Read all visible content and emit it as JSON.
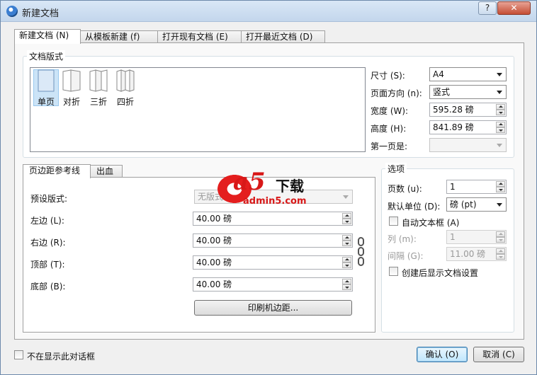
{
  "window": {
    "title": "新建文档"
  },
  "titlebar": {
    "help_label": "?",
    "close_label": "✕"
  },
  "tabs": [
    {
      "label": "新建文档 (N)"
    },
    {
      "label": "从模板新建 (f)"
    },
    {
      "label": "打开现有文档 (E)"
    },
    {
      "label": "打开最近文档 (D)"
    }
  ],
  "format": {
    "group_title": "文档版式",
    "items": [
      {
        "label": "单页",
        "icon": "single-page-icon"
      },
      {
        "label": "对折",
        "icon": "bifold-icon"
      },
      {
        "label": "三折",
        "icon": "trifold-icon"
      },
      {
        "label": "四折",
        "icon": "fourfold-icon"
      }
    ],
    "selected": "单页"
  },
  "size": {
    "size_label": "尺寸 (S):",
    "size_value": "A4",
    "orientation_label": "页面方向 (n):",
    "orientation_value": "竖式",
    "width_label": "宽度 (W):",
    "width_value": "595.28 磅",
    "height_label": "高度 (H):",
    "height_value": "841.89 磅",
    "first_page_label": "第一页是:",
    "first_page_value": ""
  },
  "inner_tabs": [
    {
      "label": "页边距参考线"
    },
    {
      "label": "出血"
    }
  ],
  "margins": {
    "preset_label": "预设版式:",
    "preset_value": "无版式",
    "left_label": "左边 (L):",
    "left_value": "40.00 磅",
    "right_label": "右边 (R):",
    "right_value": "40.00 磅",
    "top_label": "顶部 (T):",
    "top_value": "40.00 磅",
    "bottom_label": "底部 (B):",
    "bottom_value": "40.00 磅",
    "printer_button": "印刷机边距..."
  },
  "options": {
    "group_title": "选项",
    "pages_label": "页数 (u):",
    "pages_value": "1",
    "unit_label": "默认单位 (D):",
    "unit_value": "磅 (pt)",
    "auto_textframe_label": "自动文本框 (A)",
    "columns_label": "列 (m):",
    "columns_value": "1",
    "gap_label": "间隔 (G):",
    "gap_value": "11.00 磅",
    "show_settings_label": "创建后显示文档设置"
  },
  "footer": {
    "dont_show_label": "不在显示此对话框",
    "ok_label": "确认 (O)",
    "cancel_label": "取消 (C)"
  },
  "watermark": {
    "logo_text": "a5",
    "cn_text": "下载",
    "url_text": "admin5.com"
  },
  "colors": {
    "selected_bg": "#cce4f7",
    "watermark_red": "#d81818"
  }
}
